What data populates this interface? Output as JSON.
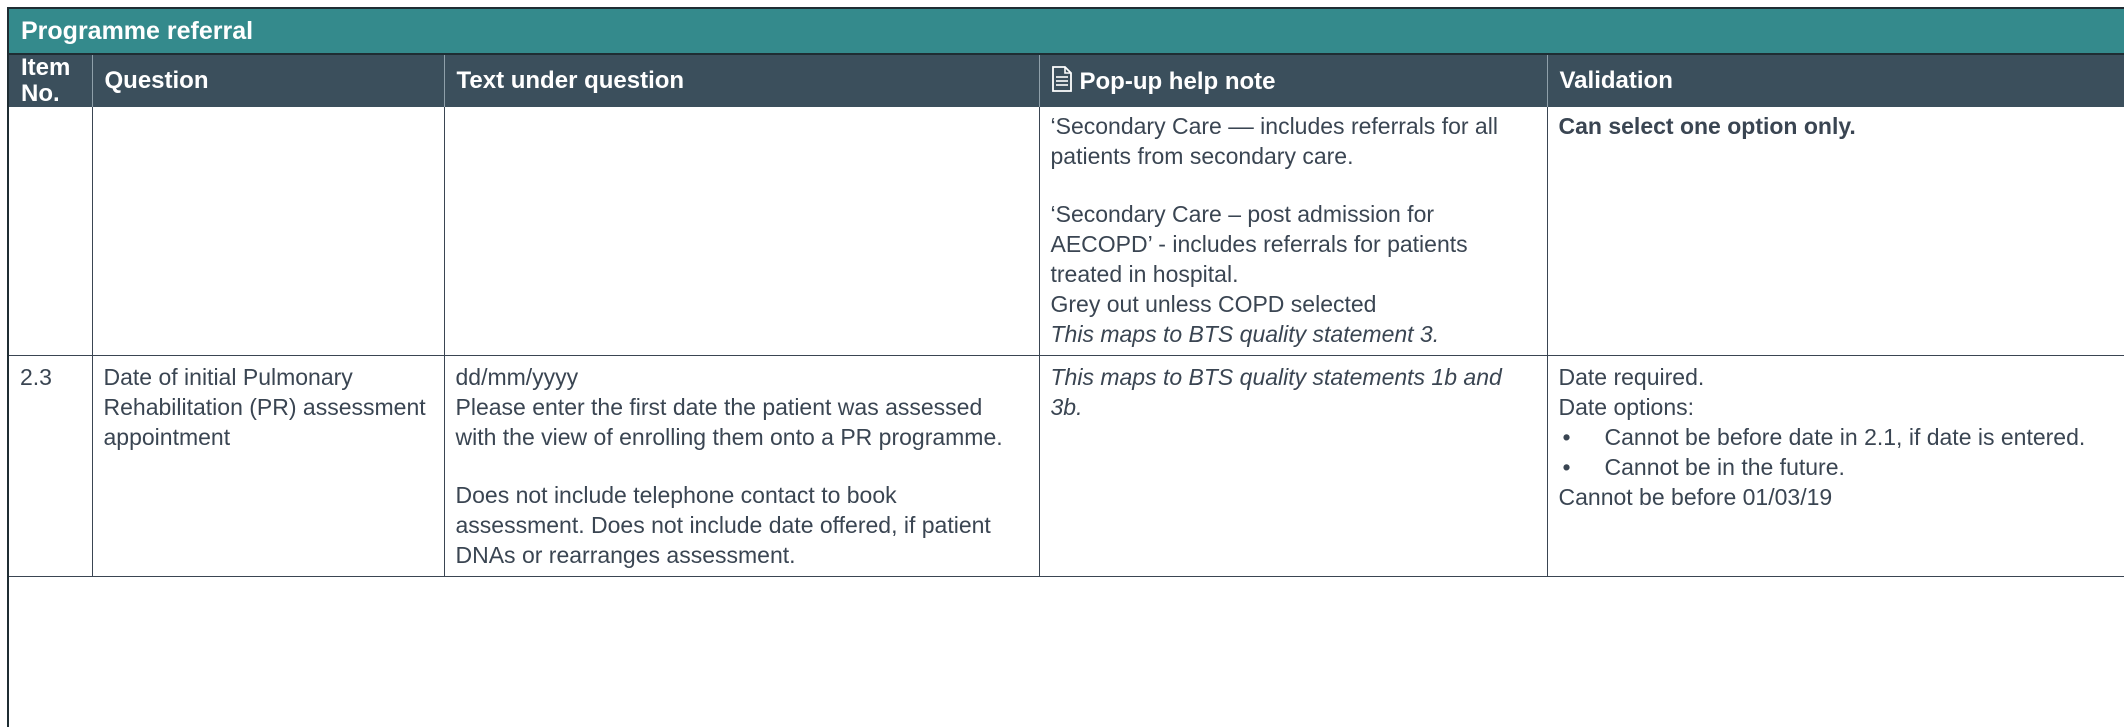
{
  "section_title": "Programme referral",
  "headers": {
    "item_no": "Item No.",
    "question": "Question",
    "text_under": "Text under question",
    "help_note": "Pop-up help note",
    "validation": "Validation"
  },
  "rows": [
    {
      "item_no": "",
      "question": "",
      "text_under": [],
      "help_note": {
        "p1": "‘Secondary Care –– includes referrals for all patients from secondary care.",
        "p2": " ‘Secondary Care – post admission for AECOPD’ - includes referrals for patients treated in hospital.",
        "p3": "Grey out unless COPD selected",
        "p4_italic": "This maps to BTS quality statement 3."
      },
      "validation": {
        "bold": "Can select one option only."
      }
    },
    {
      "item_no": "2.3",
      "question": "Date of initial Pulmonary Rehabilitation (PR) assessment appointment",
      "text_under": {
        "format": "dd/mm/yyyy",
        "p1": "Please enter the first date the patient was assessed with the view of enrolling them onto a PR programme.",
        "p2": "Does not include telephone contact to book assessment. Does not include date offered, if patient DNAs or rearranges assessment."
      },
      "help_note": {
        "italic": "This maps to BTS quality statements 1b and 3b."
      },
      "validation": {
        "l1": "Date required.",
        "l2": "Date options:",
        "bullets": [
          "Cannot be before date in 2.1, if date is entered.",
          "Cannot be in the future."
        ],
        "l3": "Cannot be before 01/03/19"
      }
    }
  ]
}
